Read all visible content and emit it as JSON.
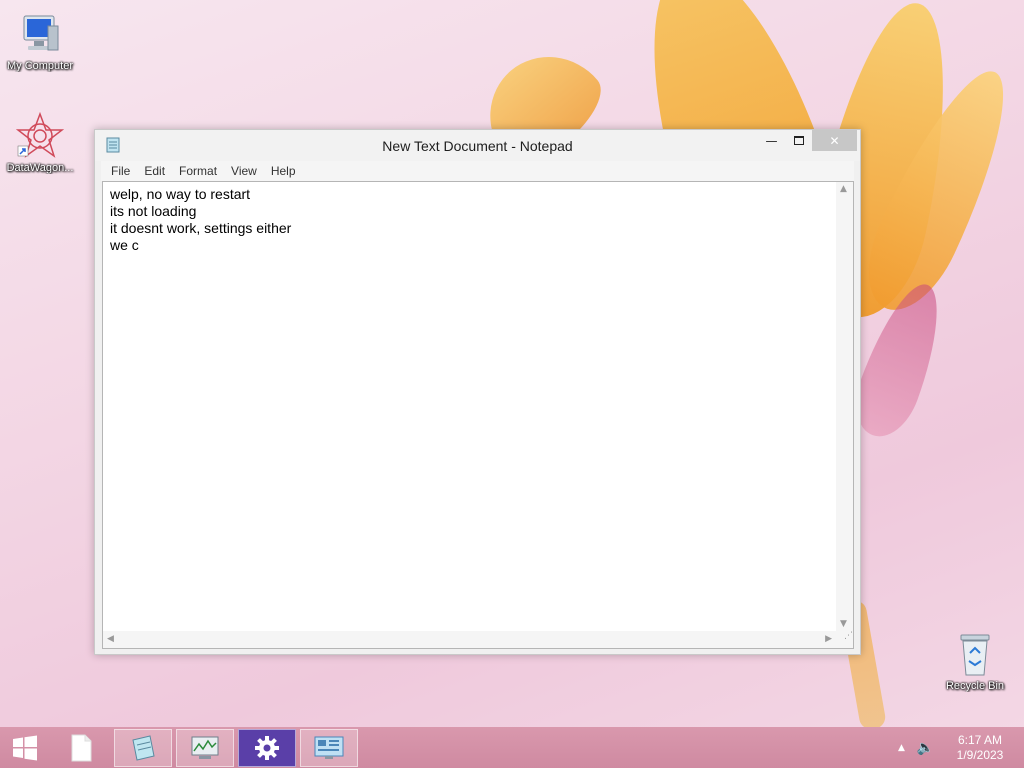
{
  "desktop": {
    "icons": [
      {
        "label": "My Computer"
      },
      {
        "label": "DataWagon..."
      },
      {
        "label": "Recycle Bin"
      }
    ]
  },
  "notepad": {
    "title": "New Text Document - Notepad",
    "menu": [
      "File",
      "Edit",
      "Format",
      "View",
      "Help"
    ],
    "content": "welp, no way to restart\nits not loading\nit doesnt work, settings either\nwe c"
  },
  "taskbar": {
    "clock_time": "6:17 AM",
    "clock_date": "1/9/2023"
  },
  "colors": {
    "taskbar": "#d998ad",
    "close_button": "#c7c7c7"
  }
}
